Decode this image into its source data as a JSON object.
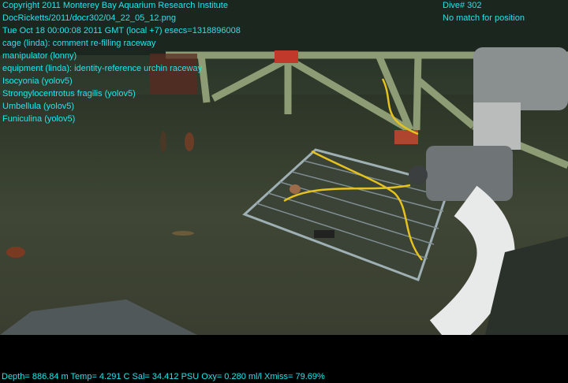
{
  "overlay": {
    "left_lines": [
      "Copyright 2011 Monterey Bay Aquarium Research Institute",
      "DocRicketts/2011/docr302/04_22_05_12.png",
      "Tue Oct 18 00:00:08 2011 GMT (local +7)  esecs=1318896008",
      "cage (linda): comment re-filling raceway",
      "manipulator (lonny)",
      "equipment (linda): identity-reference urchin raceway",
      "Isocyonia (yolov5)",
      "Strongylocentrotus fragilis (yolov5)",
      "Umbellula (yolov5)",
      "Funiculina (yolov5)"
    ],
    "right_lines": [
      "Dive# 302",
      "No match for position"
    ]
  },
  "telemetry": "Depth= 886.84 m  Temp= 4.291 C  Sal= 34.412 PSU  Oxy= 0.280 ml/l  Xmiss= 79.69%",
  "colors": {
    "overlay_text": "#22e6ee",
    "background": "#000000"
  }
}
